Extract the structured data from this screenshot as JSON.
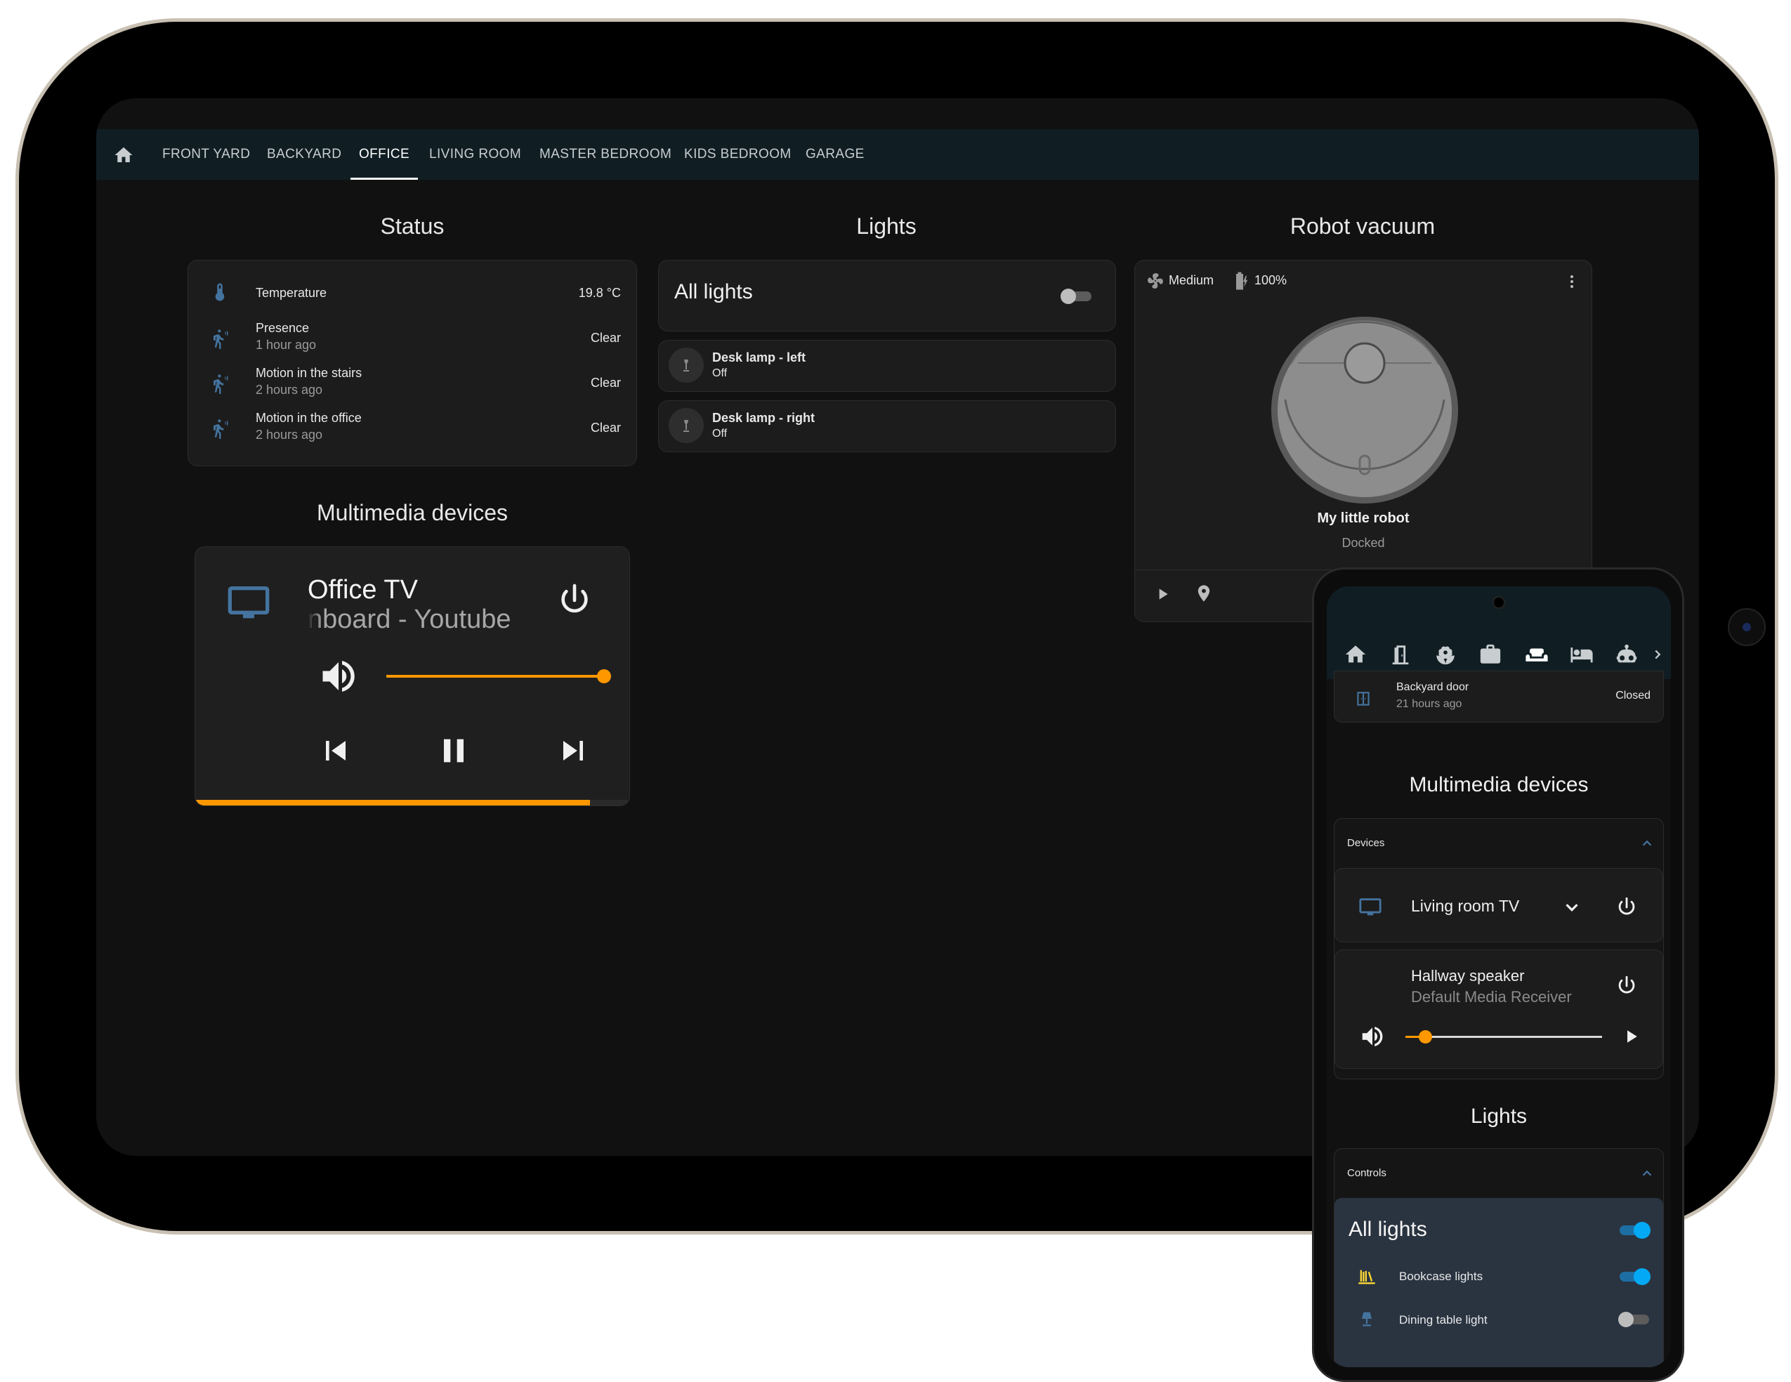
{
  "tablet": {
    "tabs": [
      {
        "label": "FRONT YARD"
      },
      {
        "label": "BACKYARD"
      },
      {
        "label": "OFFICE",
        "active": true
      },
      {
        "label": "LIVING ROOM"
      },
      {
        "label": "MASTER BEDROOM"
      },
      {
        "label": "KIDS BEDROOM"
      },
      {
        "label": "GARAGE"
      }
    ],
    "status": {
      "title": "Status",
      "rows": [
        {
          "name": "Temperature",
          "secondary": "",
          "value": "19.8 °C",
          "icon": "thermometer-icon"
        },
        {
          "name": "Presence",
          "secondary": "1 hour ago",
          "value": "Clear",
          "icon": "motion-sensor-icon"
        },
        {
          "name": "Motion in the stairs",
          "secondary": "2 hours ago",
          "value": "Clear",
          "icon": "motion-sensor-icon"
        },
        {
          "name": "Motion in the office",
          "secondary": "2 hours ago",
          "value": "Clear",
          "icon": "motion-sensor-icon"
        }
      ]
    },
    "lights": {
      "title": "Lights",
      "all_label": "All lights",
      "all_on": false,
      "lamps": [
        {
          "name": "Desk lamp - left",
          "state": "Off"
        },
        {
          "name": "Desk lamp - right",
          "state": "Off"
        }
      ]
    },
    "vacuum": {
      "title": "Robot vacuum",
      "fan_speed": "Medium",
      "battery": "100%",
      "name": "My little robot",
      "status": "Docked"
    },
    "multimedia": {
      "title": "Multimedia devices",
      "device_name": "Office TV",
      "media_title": "nboard - Youtube",
      "volume": 1.0,
      "progress": 0.91,
      "accent": "#ff9800"
    }
  },
  "phone": {
    "backyard_door": {
      "name": "Backyard door",
      "secondary": "21 hours ago",
      "value": "Closed"
    },
    "multimedia_title": "Multimedia devices",
    "devices_header": "Devices",
    "living_room_tv": "Living room TV",
    "speaker": {
      "name": "Hallway speaker",
      "source": "Default Media Receiver",
      "volume": 0.1
    },
    "lights_title": "Lights",
    "controls_header": "Controls",
    "all_lights": "All lights",
    "lights": [
      {
        "name": "Bookcase lights",
        "on": true
      },
      {
        "name": "Dining table light",
        "on": false
      }
    ],
    "accent": "#03a9f4"
  }
}
